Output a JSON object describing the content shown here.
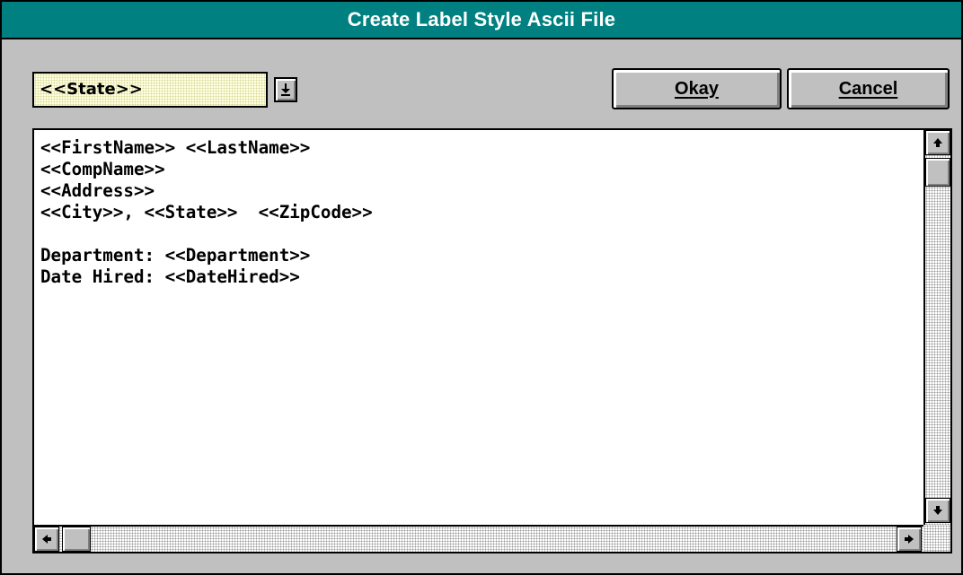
{
  "window": {
    "title": "Create Label Style Ascii File",
    "title_bar_color": "#008080"
  },
  "field_combo": {
    "selected": "<<State>>",
    "button_icon": "dropdown-arrow-icon"
  },
  "buttons": {
    "okay": {
      "accel": "O",
      "rest": "kay"
    },
    "cancel": {
      "accel": "C",
      "rest": "ancel"
    }
  },
  "editor": {
    "lines": [
      "<<FirstName>> <<LastName>>",
      "<<CompName>>",
      "<<Address>>",
      "<<City>>, <<State>>  <<ZipCode>>",
      "",
      "Department: <<Department>>",
      "Date Hired: <<DateHired>>"
    ]
  },
  "scrollbars": {
    "vertical": {
      "up_icon": "scroll-up-arrow-icon",
      "down_icon": "scroll-down-arrow-icon"
    },
    "horizontal": {
      "left_icon": "scroll-left-arrow-icon",
      "right_icon": "scroll-right-arrow-icon"
    }
  }
}
